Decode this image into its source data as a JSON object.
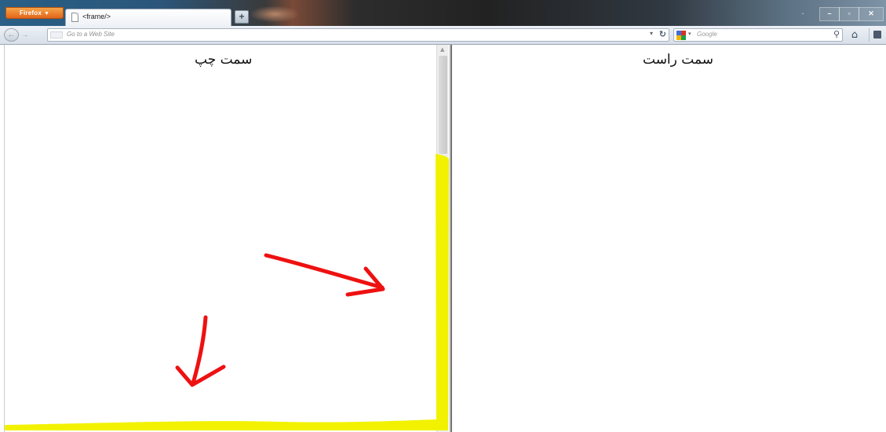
{
  "browser": {
    "menu_button_label": "Firefox",
    "tab_title": "<frame/>",
    "new_tab_label": "+",
    "window_controls": {
      "minimize": "–",
      "restore": "▫",
      "close": "✕"
    }
  },
  "navbar": {
    "url_placeholder": "Go to a Web Site",
    "search_placeholder": "Google"
  },
  "frames": {
    "left_heading": "سمت چپ",
    "right_heading": "سمت راست"
  },
  "annotations": {
    "highlight_color": "#f2f200",
    "arrow_color": "#ee1111"
  }
}
